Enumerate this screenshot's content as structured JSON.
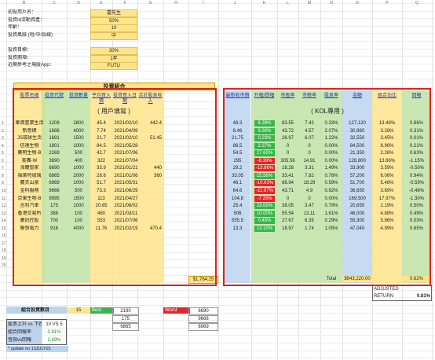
{
  "info": {
    "labels": [
      "初投用戶名：",
      "投資Id流動資產：",
      "年齡：",
      "投資風險 (短/中/長線)",
      "",
      "投資目標：",
      "投資期項：",
      "近期參考之場股App："
    ],
    "values": [
      "富先生",
      "50%",
      "10",
      "中",
      "",
      "30%",
      "1年",
      "FUTU"
    ]
  },
  "portfolio": {
    "title": "投資組合",
    "subtitle": "( 用戶填寫 )",
    "kol_title": "( KOL專用 )",
    "headers": [
      "股票名稱",
      "投資代號",
      "投資數量",
      "平均買入價",
      "投資買入日期",
      "合計股息收入",
      "最新收市價",
      "升幅/跌幅",
      "市盈率",
      "市賬率",
      "股息率",
      "金額",
      "組合佔比",
      "回報"
    ],
    "rows": [
      {
        "n": "1",
        "name": "華潤置業生活",
        "code": "1209",
        "qty": "2800",
        "avg": "45.4",
        "date": "2021/02/10",
        "div": "442.4",
        "last": "48.3",
        "chg": "6.39%",
        "pe": "83.55",
        "pb": "7.42",
        "yld": "0.33%",
        "amt": "127,120",
        "pct": "13.48%",
        "ret": "0.86%",
        "tone": "g"
      },
      {
        "n": "2",
        "name": "新意網",
        "code": "1686",
        "qty": "4000",
        "avg": "7.74",
        "date": "2021/04/09",
        "div": "0",
        "last": "8.46",
        "chg": "9.30%",
        "pe": "43.72",
        "pb": "4.57",
        "yld": "2.07%",
        "amt": "30,960",
        "pct": "3.28%",
        "ret": "0.31%",
        "tone": "g"
      },
      {
        "n": "3",
        "name": "JS環球生活",
        "code": "1691",
        "qty": "1500",
        "avg": "21.7",
        "date": "2021/02/10",
        "div": "51.45",
        "last": "21.75",
        "chg": "0.23%",
        "pe": "26.97",
        "pb": "6.07",
        "yld": "1.22%",
        "amt": "32,550",
        "pct": "3.45%",
        "ret": "0.01%",
        "tone": "g"
      },
      {
        "n": "4",
        "name": "信達生物",
        "code": "1801",
        "qty": "1000",
        "avg": "84.5",
        "date": "2021/05/28",
        "div": "0",
        "last": "86.5",
        "chg": "2.37%",
        "pe": "0",
        "pb": "0",
        "yld": "0.00%",
        "amt": "84,500",
        "pct": "8.96%",
        "ret": "0.21%",
        "tone": "g"
      },
      {
        "n": "5",
        "name": "藥明生物-B",
        "code": "2269",
        "qty": "500",
        "avg": "42.7",
        "date": "2021/07/06",
        "div": "0",
        "last": "54.5",
        "chg": "27.63%",
        "pe": "0",
        "pb": "0",
        "yld": "0.00%",
        "amt": "21,350",
        "pct": "2.26%",
        "ret": "0.63%",
        "tone": "g"
      },
      {
        "n": "6",
        "name": "美團-W",
        "code": "3690",
        "qty": "400",
        "avg": "322",
        "date": "2021/07/04",
        "div": "0",
        "last": "295",
        "chg": "-8.39%",
        "pe": "305.56",
        "pb": "14.91",
        "yld": "0.00%",
        "amt": "128,800",
        "pct": "13.66%",
        "ret": "-1.15%",
        "tone": "r"
      },
      {
        "n": "7",
        "name": "海爾智家",
        "code": "6690",
        "qty": "1000",
        "avg": "33.9",
        "date": "2021/01/21",
        "div": "440",
        "last": "29.2",
        "chg": "-13.86%",
        "pe": "18.28",
        "pb": "3.31",
        "yld": "1.49%",
        "amt": "33,900",
        "pct": "3.59%",
        "ret": "-0.50%",
        "tone": "r"
      },
      {
        "n": "8",
        "name": "福萊特玻璃",
        "code": "6865",
        "qty": "2000",
        "avg": "28.6",
        "date": "2021/01/06",
        "div": "360",
        "last": "33.05",
        "chg": "15.56%",
        "pe": "33.41",
        "pb": "7.82",
        "yld": "0.78%",
        "amt": "57,200",
        "pct": "6.06%",
        "ret": "0.94%",
        "tone": "g"
      },
      {
        "n": "9",
        "name": "農夫山泉",
        "code": "6969",
        "qty": "1000",
        "avg": "51.7",
        "date": "2021/05/31",
        "div": "0",
        "last": "46.1",
        "chg": "-10.83%",
        "pe": "86.94",
        "pb": "18.29",
        "yld": "0.59%",
        "amt": "51,700",
        "pct": "5.48%",
        "ret": "-0.59%",
        "tone": "r"
      },
      {
        "n": "10",
        "name": "金科服務",
        "code": "9666",
        "qty": "500",
        "avg": "73.3",
        "date": "2021/06/29",
        "div": "0",
        "last": "64.6",
        "chg": "-11.87%",
        "pe": "43.71",
        "pb": "4.9",
        "yld": "0.92%",
        "amt": "36,650",
        "pct": "3.89%",
        "ret": "-0.46%",
        "tone": "r"
      },
      {
        "n": "11",
        "name": "京東生物-B",
        "code": "9995",
        "qty": "1500",
        "avg": "113",
        "date": "2021/04/27",
        "div": "0",
        "last": "104.8",
        "chg": "-7.26%",
        "pe": "0",
        "pb": "0",
        "yld": "0.00%",
        "amt": "169,500",
        "pct": "17.97%",
        "ret": "-1.30%",
        "tone": "r"
      },
      {
        "n": "12",
        "name": "吉利汽車",
        "code": "175",
        "qty": "1000",
        "avg": "20.65",
        "date": "2021/06/02",
        "div": "0",
        "last": "25.4",
        "chg": "23.00%",
        "pe": "38.05",
        "pb": "3.47",
        "yld": "0.79%",
        "amt": "20,650",
        "pct": "2.19%",
        "ret": "0.50%",
        "tone": "g"
      },
      {
        "n": "13",
        "name": "香港交易所",
        "code": "388",
        "qty": "100",
        "avg": "460",
        "date": "2021/03/11",
        "div": "0",
        "last": "506",
        "chg": "10.00%",
        "pe": "55.54",
        "pb": "13.11",
        "yld": "1.61%",
        "amt": "46,000",
        "pct": "4.88%",
        "ret": "0.49%",
        "tone": "g"
      },
      {
        "n": "14",
        "name": "騰訊控股",
        "code": "700",
        "qty": "100",
        "avg": "553",
        "date": "2021/07/06",
        "div": "0",
        "last": "555.5",
        "chg": "0.45%",
        "pe": "27.67",
        "pb": "6.35",
        "yld": "0.29%",
        "amt": "55,300",
        "pct": "5.86%",
        "ret": "0.03%",
        "tone": "g"
      },
      {
        "n": "15",
        "name": "聯想電力",
        "code": "916",
        "qty": "4000",
        "avg": "11.76",
        "date": "2021/02/19",
        "div": "470.4",
        "last": "13.3",
        "chg": "13.10%",
        "pe": "18.97",
        "pb": "1.74",
        "yld": "1.05%",
        "amt": "47,040",
        "pct": "4.99%",
        "ret": "0.65%",
        "tone": "g"
      }
    ],
    "empty_rows": [
      "16",
      "17",
      "18",
      "19",
      "20"
    ],
    "div_total": "$1,764.25",
    "total_label": "Total",
    "total_amount": "$943,220.00",
    "total_return": "0.62%",
    "adjusted_label": "ADJUSTED",
    "return_label": "RETURN",
    "adjusted_return": "0.81%"
  },
  "summary": {
    "count_label": "組合投資數目",
    "count_value": "15",
    "best_label": "Best",
    "best_value": "2190",
    "worst_label": "Worst",
    "worst_value": "6690",
    "col_e": [
      "175",
      "6865"
    ],
    "col_h": [
      "9666",
      "6969"
    ],
    "updown_label": "股票上升 vs 下跌",
    "updown_value": "10 VS 5",
    "ret_label": "組合回報率",
    "ret_value": "0.81%",
    "hsi_label": "恆指vs回報",
    "hsi_value": "2.69%",
    "update_note": "* update on 13JULY21"
  },
  "colors": {
    "red_border": "#e02020",
    "green": "#36b54a",
    "red": "#e8232a",
    "yellow": "#ffe48a",
    "light_green": "#bfe3a6",
    "blue": "#bcd3ee"
  }
}
